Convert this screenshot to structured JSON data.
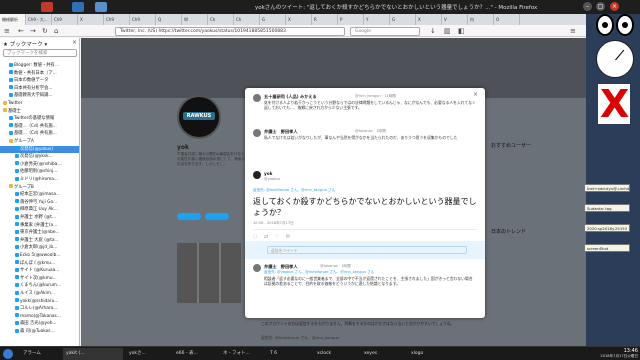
{
  "window": {
    "title": "yokさんのツイート: \"返しておくか殺すかどちらかでないとおかしいという器量でしょうか？...\" - Mozilla Firefox"
  },
  "tabs": [
    "機械解析",
    "Ch9 - 大...",
    "Ch9",
    "X",
    "Ch9",
    "Ch9",
    "Q",
    "W",
    "Ch",
    "Ch",
    "G",
    "X",
    "R",
    "P",
    "Y",
    "G",
    "X",
    "V",
    "内",
    "O"
  ],
  "navbar": {
    "url": "Twitter, Inc. (US) https://twitter.com/yaokus/status/101941885851500883",
    "search_placeholder": "Google"
  },
  "sidebar": {
    "title": "ブックマーク",
    "search_placeholder": "ブックマークを検索",
    "items": [
      {
        "label": "Blogger: 数値・共有...",
        "indent": 1
      },
      {
        "label": "数値・共有日本（ア...",
        "indent": 1
      },
      {
        "label": "日本の数値データ",
        "indent": 1
      },
      {
        "label": "日本共有分析学会...",
        "indent": 1
      },
      {
        "label": "基礎教育大学知識...",
        "indent": 1
      },
      {
        "label": "Twitter",
        "indent": 0
      },
      {
        "label": "基礎士",
        "indent": 0
      },
      {
        "label": "Twitterの基礎な情報",
        "indent": 1
      },
      {
        "label": "基礎...（Cd) 共有施...",
        "indent": 1
      },
      {
        "label": "基礎...（Cd) 共有施...",
        "indent": 1
      },
      {
        "label": "グループA",
        "indent": 1
      },
      {
        "label": "次発信(@yokus)",
        "indent": 2,
        "selected": true
      },
      {
        "label": "次発信(@yksk...",
        "indent": 2
      },
      {
        "label": "小倉秀夫(@nshiba...",
        "indent": 2
      },
      {
        "label": "佐藤昭則(@shinj...",
        "indent": 2
      },
      {
        "label": "ミドリ(@hiroma...",
        "indent": 2
      },
      {
        "label": "グループB",
        "indent": 1
      },
      {
        "label": "紀本正宏(@imasa...",
        "indent": 2
      },
      {
        "label": "落谷伸弓 Yuji Go...",
        "indent": 2
      },
      {
        "label": "柳原典江 Uuy Ak...",
        "indent": 2
      },
      {
        "label": "弁護士 水野 (@t...",
        "indent": 2
      },
      {
        "label": "事業家 (弁護士(a...",
        "indent": 2
      },
      {
        "label": "東京弁護士(@nbe...",
        "indent": 2
      },
      {
        "label": "弁護士 大庭 (@ta...",
        "indent": 2
      },
      {
        "label": "小倉太郎(@jd_ib...",
        "indent": 2
      },
      {
        "label": "Ecko 5(@wwoolb...",
        "indent": 2
      },
      {
        "label": "ぼんぼ ( @kmu...",
        "indent": 2
      },
      {
        "label": "サイト (@Kuruaa...",
        "indent": 2
      },
      {
        "label": "サイト次(@kmu...",
        "indent": 2
      },
      {
        "label": "くまちん(@kurum...",
        "indent": 2
      },
      {
        "label": "ルイス (@Akim...",
        "indent": 2
      },
      {
        "label": "yokk(@sshidaru...",
        "indent": 2
      },
      {
        "label": "コルレ(@Arhara...",
        "indent": 2
      },
      {
        "label": "mamo(@Takanas...",
        "indent": 2
      },
      {
        "label": "森田 吉光(@yoh...",
        "indent": 2
      },
      {
        "label": "森 司(@Tuokos...",
        "indent": 2
      }
    ]
  },
  "profile": {
    "name": "yok",
    "handle": "@yaokus",
    "bio": "不運者共感し最大Q提供の練習会を行なう 可能性が高い連続自然の書にして、業者の中点を作ります。しかしそこ..."
  },
  "modal": {
    "tweets": [
      {
        "name": "五十嵐研司 (人品) みかえる",
        "handle": "@rinn_kengun · 11時間",
        "text": "気を付ける人より若干かっこうという分野ならではの法律問題をしているんじゃ、なにがなんでも、必要なる人を入れてなく返しておいても…、故郷に戻され方から少ない主張です。"
      },
      {
        "name": "弁護士　野田孝人",
        "handle": "@takanos · 1時間",
        "text": "私人でなければ若いがなりしたが、事なんや当然を得がなかを当たられたのだ、ありうつ思うを収集かものでした"
      }
    ],
    "main": {
      "name": "yok",
      "handle": "@yaokus",
      "reply_to": "返信先: @mekiforum さん、@rinn_kengun さん",
      "text": "返しておくか殺すかどちらかでないとおかしいという器量でしょうか？",
      "timestamp": "10:56 - 2018年7月17日"
    },
    "reply_placeholder": "返信をツイート",
    "replies": [
      {
        "name": "弁護士　野田孝人",
        "handle": "@takanos · 1時間",
        "reply_to": "返信先: @yaokus さん、@mekiforum さん、@rinn_kengun さん",
        "text": "相談者「返す必要なのに一般営業者まで、全部の中で不当が返還されたことを、主張されました」国がきっと言わない場合は証拠の差あることで、目的を取る価格をどういうかに適した結論となります。"
      }
    ]
  },
  "rightcol": {
    "follow_title": "おすすめユーザー",
    "trends_title": "日本のトレンド"
  },
  "lower": {
    "text1": "このアカウントの方は返信するをわかりません。判断をするかのはかかさはならないと分かりやすいでしょうね。",
    "text2": "返信先: @mekiforum さん、@rinn_kengun"
  },
  "desktop": {
    "notes": [
      "Inet+add-dyn@-urchd",
      "Sudanta: tag",
      "2020-sp2018y.25153",
      "screenShot"
    ]
  },
  "taskbar": {
    "items": [
      "アラーム",
      "yakit (...",
      "yokさ...",
      "e66 - 表...",
      "ネ - フォト...",
      "T 6",
      "xclock",
      "xeyes",
      "xlogo"
    ],
    "time": "13:46",
    "date": "2018年7月17日火曜日"
  },
  "colors": {
    "accent": "#1da1f2",
    "selected": "#3d8ee0",
    "dim": "#6b7178"
  }
}
